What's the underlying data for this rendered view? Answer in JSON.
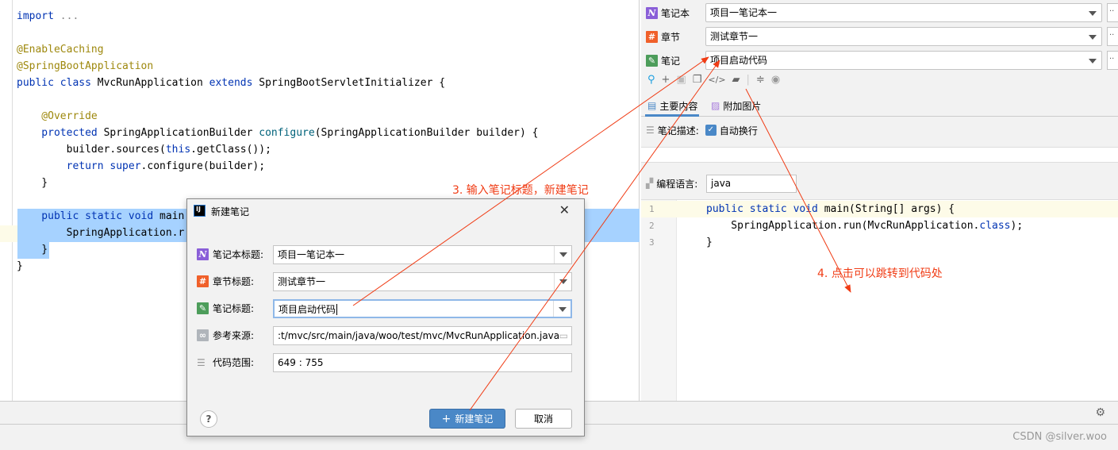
{
  "editor": {
    "lines": [
      [
        [
          "import ",
          "kw"
        ],
        [
          "...",
          "cm"
        ]
      ],
      [],
      [
        [
          "@EnableCaching",
          "an"
        ]
      ],
      [
        [
          "@SpringBootApplication",
          "an"
        ]
      ],
      [
        [
          "public class ",
          "kw"
        ],
        [
          "MvcRunApplication ",
          ""
        ],
        [
          "extends ",
          "kw"
        ],
        [
          "SpringBootServletInitializer {",
          ""
        ]
      ],
      [],
      [
        [
          "    @Override",
          "an"
        ]
      ],
      [
        [
          "    protected ",
          "kw"
        ],
        [
          "SpringApplicationBuilder ",
          ""
        ],
        [
          "configure",
          "fn"
        ],
        [
          "(SpringApplicationBuilder builder) {",
          ""
        ]
      ],
      [
        [
          "        builder.sources(",
          ""
        ],
        [
          "this",
          "kw"
        ],
        [
          ".getClass());",
          ""
        ]
      ],
      [
        [
          "        return super",
          "kw"
        ],
        [
          ".configure(builder);",
          ""
        ]
      ],
      [
        [
          "    }",
          ""
        ]
      ],
      [],
      [
        [
          "    public static void ",
          "kw"
        ],
        [
          "main",
          ""
        ]
      ],
      [
        [
          "        SpringApplication.r",
          ""
        ]
      ],
      [
        [
          "    }",
          ""
        ]
      ],
      [
        [
          "}",
          ""
        ]
      ]
    ]
  },
  "panel": {
    "notebook_label": "笔记本",
    "notebook_value": "项目一笔记本一",
    "chapter_label": "章节",
    "chapter_value": "测试章节一",
    "note_label": "笔记",
    "note_value": "项目启动代码",
    "more": "··",
    "tab_main": "主要内容",
    "tab_images": "附加图片",
    "desc_label": "笔记描述:",
    "wrap_label": "自动换行",
    "wrap_checked": true,
    "lang_label": "编程语言:",
    "lang_value": "java",
    "code_line_numbers": [
      "1",
      "2",
      "3"
    ],
    "code_lines": [
      [
        [
          "public static void ",
          "kw"
        ],
        [
          "main(String[] args) {",
          ""
        ]
      ],
      [
        [
          "    SpringApplication.run(MvcRunApplication.",
          ""
        ],
        [
          "class",
          "kw"
        ],
        [
          ");",
          ""
        ]
      ],
      [
        [
          "}",
          ""
        ]
      ]
    ]
  },
  "dialog": {
    "title": "新建笔记",
    "notebook_label": "笔记本标题:",
    "notebook_value": "项目一笔记本一",
    "chapter_label": "章节标题:",
    "chapter_value": "测试章节一",
    "note_label": "笔记标题:",
    "note_value": "项目启动代码",
    "source_label": "参考来源:",
    "source_value": ":t/mvc/src/main/java/woo/test/mvc/MvcRunApplication.java",
    "range_label": "代码范围:",
    "range_value": "649 : 755",
    "help": "?",
    "create_label": "新建笔记",
    "cancel_label": "取消"
  },
  "annotations": {
    "step3": "3. 输入笔记标题，新建笔记",
    "step4": "4. 点击可以跳转到代码处"
  },
  "watermark": "CSDN @silver.woo",
  "colors": {
    "accent": "#4a88c7",
    "annotation": "#f03c15",
    "selection": "#a6d2ff"
  }
}
